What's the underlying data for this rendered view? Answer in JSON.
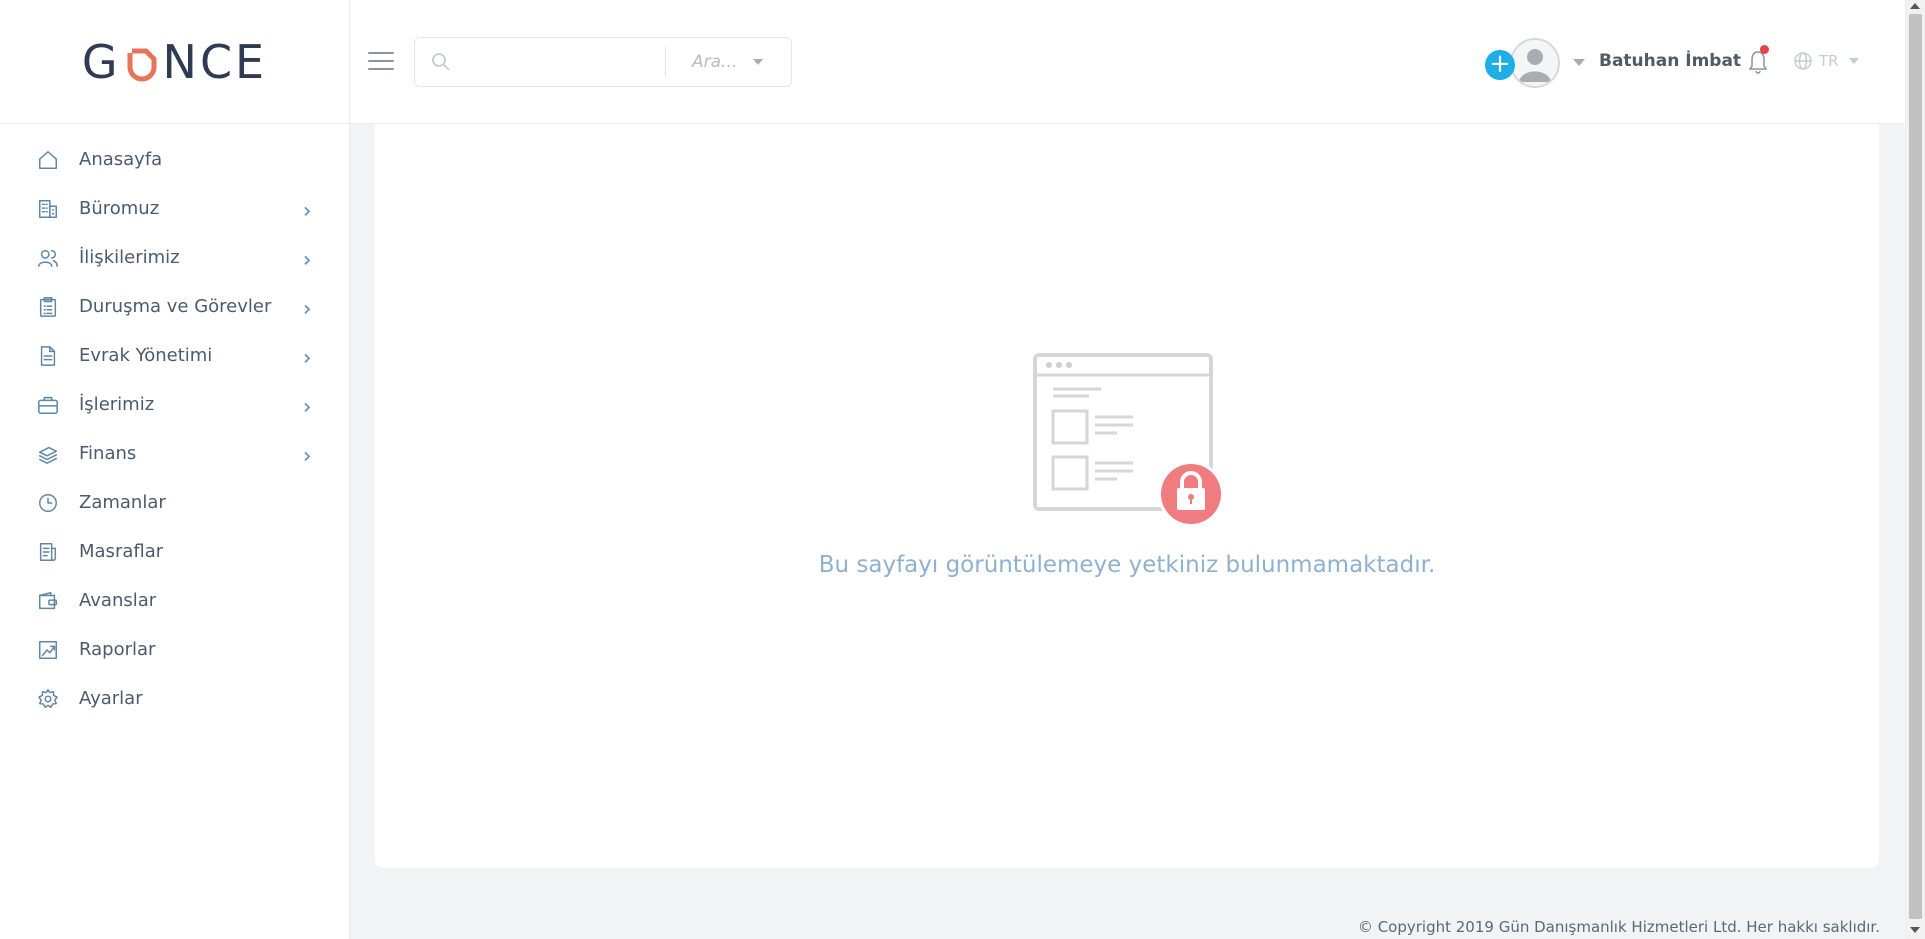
{
  "brand": {
    "logo_text_left": "G",
    "logo_text_right": "NCE",
    "logo_accent_color": "#e8735a",
    "logo_color": "#2f3b52"
  },
  "sidebar": {
    "items": [
      {
        "label": "Anasayfa",
        "icon": "home-icon",
        "has_submenu": false
      },
      {
        "label": "Büromuz",
        "icon": "building-icon",
        "has_submenu": true
      },
      {
        "label": "İlişkilerimiz",
        "icon": "users-icon",
        "has_submenu": true
      },
      {
        "label": "Duruşma ve Görevler",
        "icon": "clipboard-list-icon",
        "has_submenu": true
      },
      {
        "label": "Evrak Yönetimi",
        "icon": "document-icon",
        "has_submenu": true
      },
      {
        "label": "İşlerimiz",
        "icon": "briefcase-icon",
        "has_submenu": true
      },
      {
        "label": "Finans",
        "icon": "money-stack-icon",
        "has_submenu": true
      },
      {
        "label": "Zamanlar",
        "icon": "clock-icon",
        "has_submenu": false
      },
      {
        "label": "Masraflar",
        "icon": "receipt-icon",
        "has_submenu": false
      },
      {
        "label": "Avanslar",
        "icon": "wallet-icon",
        "has_submenu": false
      },
      {
        "label": "Raporlar",
        "icon": "chart-report-icon",
        "has_submenu": false
      },
      {
        "label": "Ayarlar",
        "icon": "gear-icon",
        "has_submenu": false
      }
    ]
  },
  "header": {
    "search": {
      "placeholder": "",
      "filter_label": "Ara..."
    },
    "add_button_label": "+",
    "user_name": "Batuhan İmbat",
    "language": "TR",
    "notification_dot_color": "#e8404b",
    "add_button_color": "#1dade7"
  },
  "main": {
    "message": "Bu sayfayı görüntülemeye yetkiniz bulunmamaktadır.",
    "message_color": "#8fb1d1",
    "lock_color": "#f07c80"
  },
  "footer": {
    "copyright": "© Copyright 2019 Gün Danışmanlık Hizmetleri Ltd. Her hakkı saklıdır."
  }
}
